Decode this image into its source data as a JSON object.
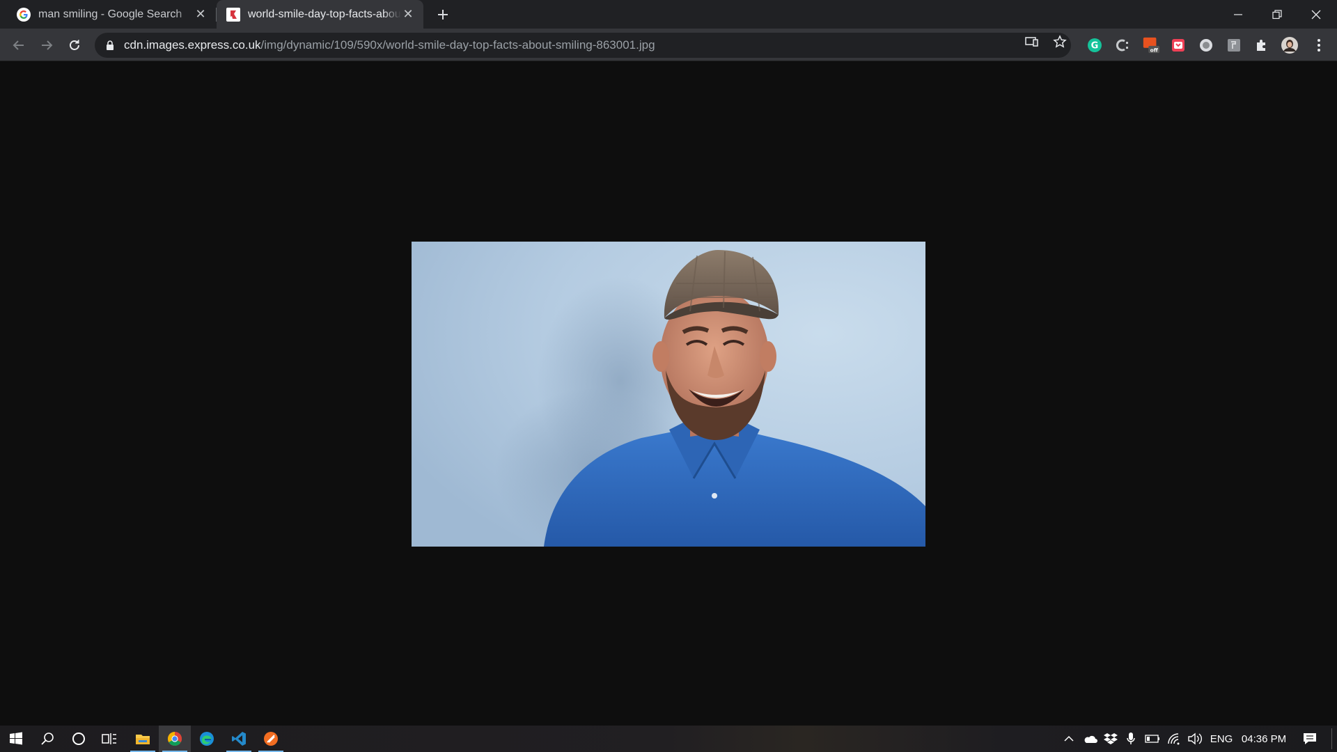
{
  "browser": {
    "tabs": [
      {
        "title": "man smiling - Google Search",
        "favicon": "google-g-icon"
      },
      {
        "title": "world-smile-day-top-facts-about-smiling-863001.jpg",
        "favicon": "express-icon",
        "active": true
      }
    ],
    "omnibox": {
      "host": "cdn.images.express.co.uk",
      "path": "/img/dynamic/109/590x/world-smile-day-top-facts-about-smiling-863001.jpg"
    },
    "extensions": [
      "grammarly-icon",
      "clipboard-icon",
      "coupon-off-icon",
      "pocket-icon",
      "record-icon",
      "notes-icon",
      "puzzle-icon",
      "profile-avatar"
    ],
    "colors": {
      "tabstrip": "#202124",
      "toolbar": "#35363a",
      "page_bg": "#0e0e0e"
    }
  },
  "content": {
    "image": {
      "subject": "smiling-man-photo",
      "colors": {
        "background": "#b7cde2",
        "shirt": "#2f6ec2",
        "cap": "#7b6a5a",
        "skin": "#c98a6a"
      }
    }
  },
  "taskbar": {
    "apps": [
      "start-icon",
      "search-icon",
      "cortana-icon",
      "task-view-icon",
      "file-explorer-icon",
      "chrome-icon",
      "edge-icon",
      "vscode-icon",
      "app-orange-icon"
    ],
    "tray": {
      "language": "ENG",
      "time": "04:36 PM"
    }
  }
}
